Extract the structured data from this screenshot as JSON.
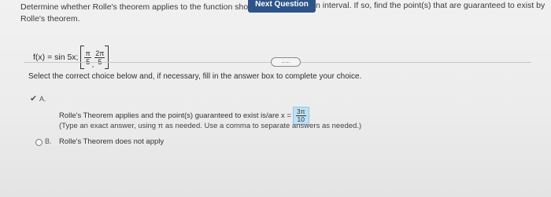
{
  "question": {
    "line1_start": "Determine whether Rolle's theorem applies to the function sho",
    "line1_end": "n interval. If so, find the point(s) that are guaranteed to exist by",
    "line2": "Rolle's theorem."
  },
  "next_button": {
    "label": "Next Question"
  },
  "function": {
    "prefix": "f(x) = sin 5x;",
    "interval_left_num": "π",
    "interval_left_den": "5",
    "interval_right_num": "2π",
    "interval_right_den": "5"
  },
  "expand_pill": {
    "label": "....."
  },
  "instruction": "Select the correct choice below and, if necessary, fill in the answer box to complete your choice.",
  "option_a": {
    "letter": "A.",
    "check_icon": "✔",
    "text": "Rolle's Theorem applies and the point(s) guaranteed to exist is/are x =",
    "answer_num": "3π",
    "answer_den": "10",
    "hint": "(Type an exact answer, using π as needed. Use a comma to separate answers as needed.)"
  },
  "option_b": {
    "letter": "B.",
    "text": "Rolle's Theorem does not apply"
  },
  "colors": {
    "button_bg": "#2d5488",
    "answer_box_bg": "#bfe0f4"
  }
}
